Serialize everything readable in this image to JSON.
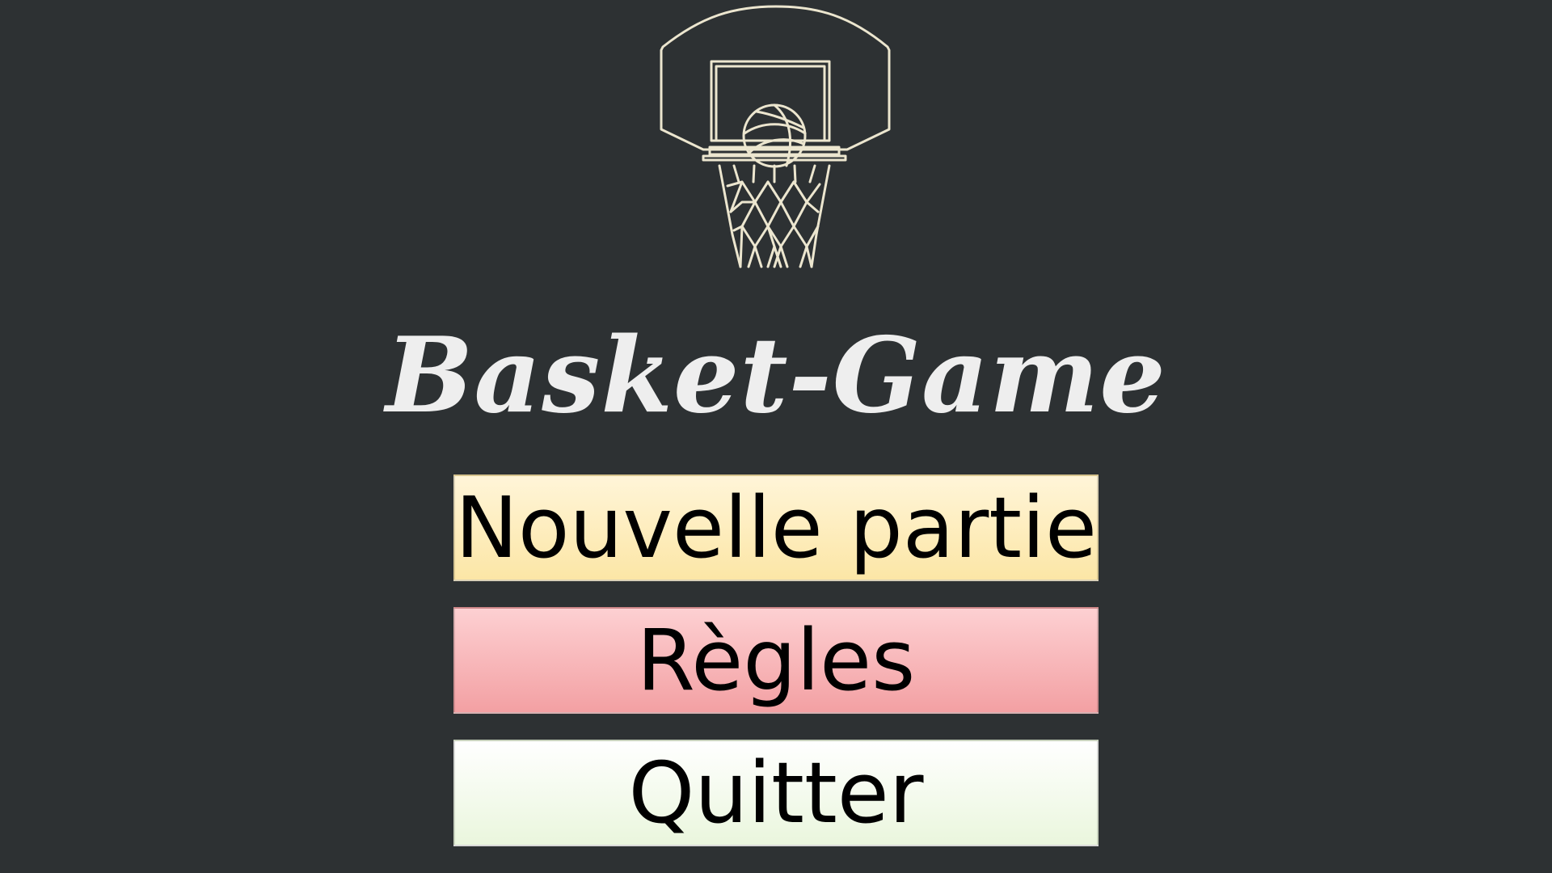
{
  "game": {
    "title": "Basket-Game"
  },
  "logo": {
    "icon": "basketball-hoop-icon",
    "color": "#ece6cf"
  },
  "menu": {
    "new_game_label": "Nouvelle partie",
    "rules_label": "Règles",
    "quit_label": "Quitter"
  },
  "colors": {
    "background": "#2d3133",
    "title": "#eeeeee",
    "new_game": "#fce6a6",
    "rules": "#f3a0a3",
    "quit": "#eaf6dd"
  }
}
